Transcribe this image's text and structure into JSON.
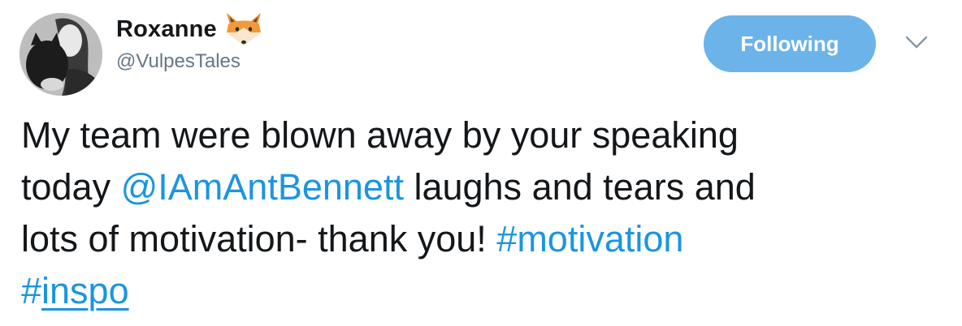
{
  "author": {
    "display_name": "Roxanne",
    "handle": "@VulpesTales",
    "name_emoji": "fox-face-icon",
    "avatar": "avatar-photo"
  },
  "actions": {
    "follow_label": "Following",
    "menu_icon": "chevron-down-icon"
  },
  "tweet": {
    "line1": "My team were blown away by your speaking",
    "line2_start": "today ",
    "mention": "@IAmAntBennett",
    "line2_end": " laughs and tears and",
    "line3_start": "lots of motivation- thank you! ",
    "hashtag1": "#motivation",
    "hashtag2_hash": "#",
    "hashtag2_word": "inspo"
  },
  "colors": {
    "text": "#14171a",
    "secondary": "#657786",
    "link": "#1b95e0",
    "button_bg": "#6cb3ea",
    "button_text": "#ffffff"
  }
}
